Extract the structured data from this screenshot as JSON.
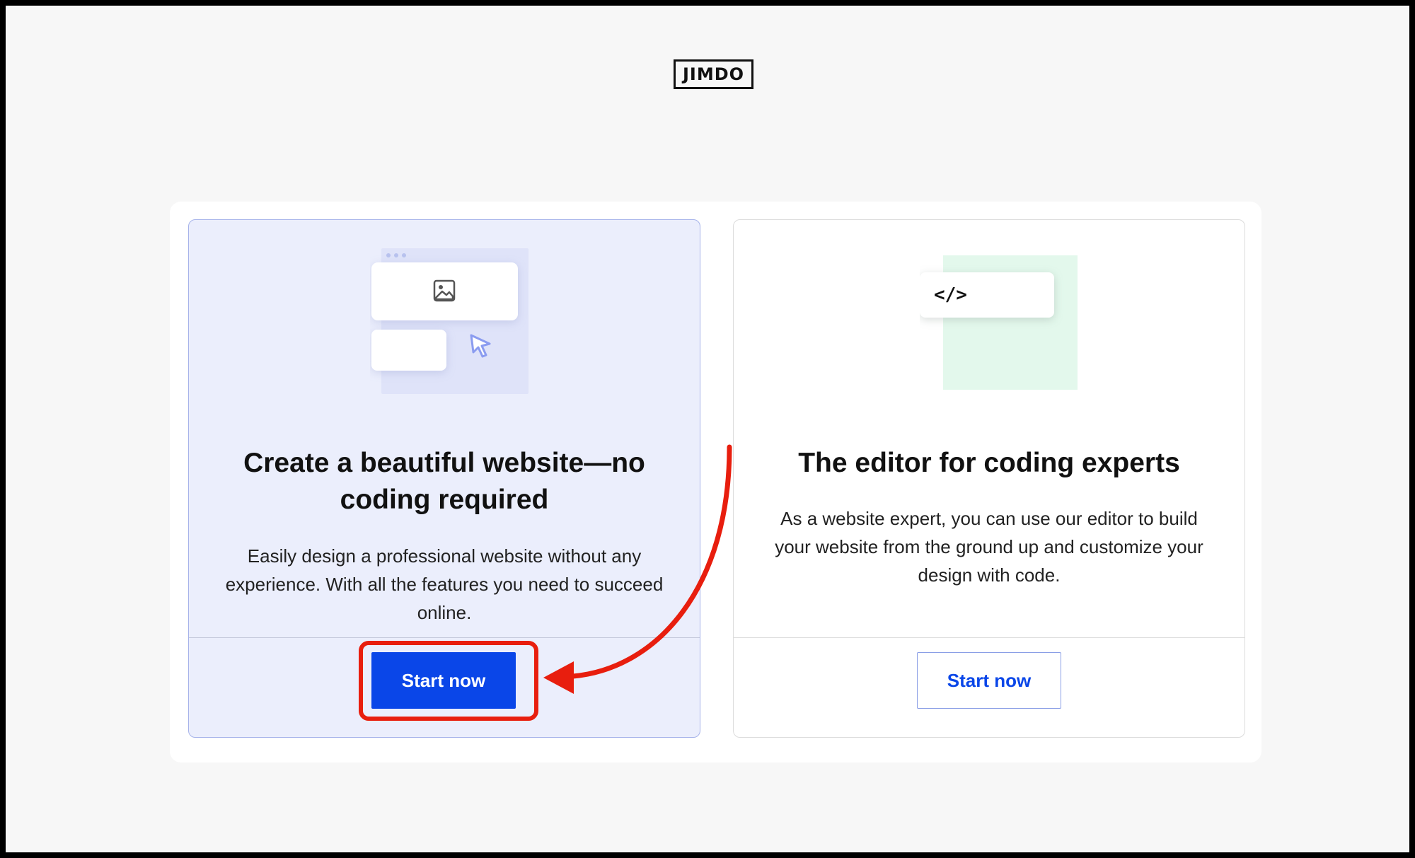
{
  "logo": {
    "text": "JIMDO"
  },
  "cards": [
    {
      "title": "Create a beautiful website—no coding required",
      "description": "Easily design a professional website without any experience. With all the features you need to succeed online.",
      "button_label": "Start now"
    },
    {
      "title": "The editor for coding experts",
      "description": "As a website expert, you can use our editor to build your website from the ground up and customize your design with code.",
      "button_label": "Start now",
      "code_icon_text": "</>"
    }
  ],
  "colors": {
    "primary_blue": "#0a46e8",
    "annotation_red": "#e81e0e",
    "card_left_bg": "#ebeefc",
    "illustration_green": "#e3f8ec"
  }
}
